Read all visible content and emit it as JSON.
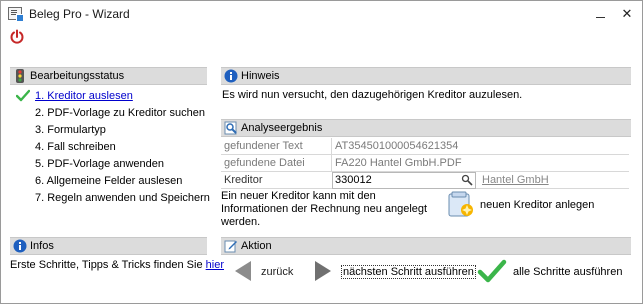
{
  "window": {
    "title": "Beleg Pro - Wizard",
    "minimize_label": "",
    "close_label": "✕"
  },
  "status_panel": {
    "title": "Bearbeitungsstatus",
    "steps": [
      {
        "label": "1. Kreditor auslesen",
        "state": "current"
      },
      {
        "label": "2. PDF-Vorlage zu Kreditor suchen",
        "state": "pending"
      },
      {
        "label": "3. Formulartyp",
        "state": "pending"
      },
      {
        "label": "4. Fall schreiben",
        "state": "pending"
      },
      {
        "label": "5. PDF-Vorlage anwenden",
        "state": "pending"
      },
      {
        "label": "6. Allgemeine Felder auslesen",
        "state": "pending"
      },
      {
        "label": "7. Regeln anwenden und Speichern",
        "state": "pending"
      }
    ]
  },
  "infos_panel": {
    "title": "Infos",
    "text": "Erste Schritte, Tipps & Tricks finden Sie ",
    "link": "hier"
  },
  "hinweis_panel": {
    "title": "Hinweis",
    "text": "Es wird nun versucht, den dazugehörigen Kreditor auzulesen."
  },
  "analyse_panel": {
    "title": "Analyseergebnis",
    "rows": [
      {
        "label": "gefundener Text",
        "value": "AT354501000054621354"
      },
      {
        "label": "gefundene Datei",
        "value": "FA220 Hantel GmbH.PDF"
      },
      {
        "label": "Kreditor",
        "value": "330012",
        "link": "Hantel GmbH"
      }
    ],
    "new_info": "Ein neuer Kreditor kann mit den Informationen der Rechnung neu angelegt werden.",
    "new_button": "neuen Kreditor anlegen"
  },
  "aktion_panel": {
    "title": "Aktion",
    "back": "zurück",
    "next": "nächsten Schritt ausführen",
    "all": "alle Schritte ausführen"
  },
  "colors": {
    "header_bg": "#dcdcdc",
    "link": "#0000cc",
    "check_green": "#3bb54a"
  }
}
